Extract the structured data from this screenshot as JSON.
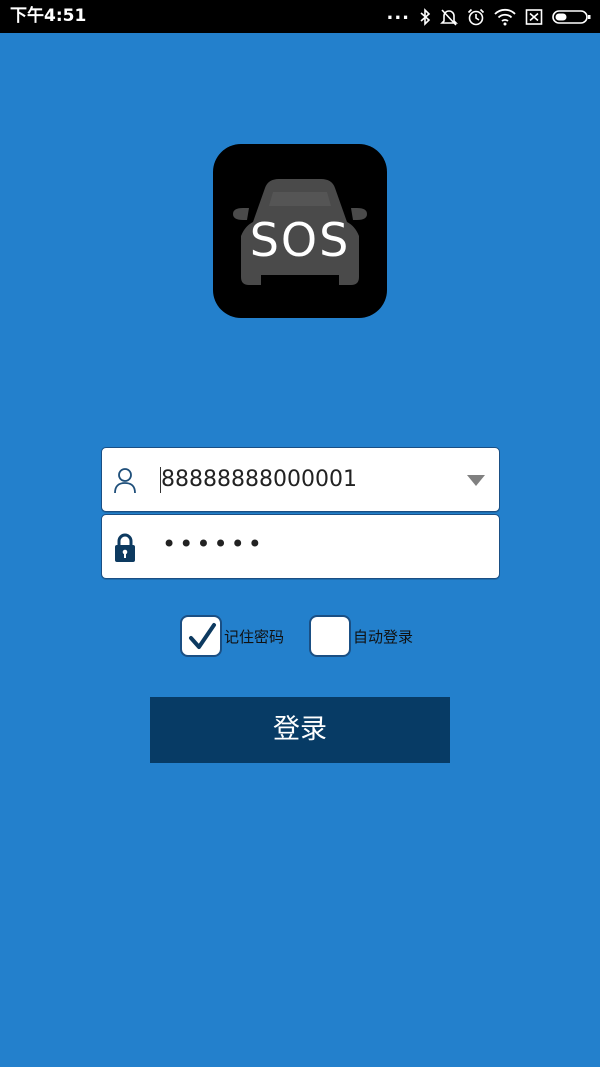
{
  "status_bar": {
    "time": "下午4:51",
    "dots": "...",
    "icons": [
      "bluetooth-icon",
      "mute-icon",
      "alarm-icon",
      "wifi-icon",
      "no-sim-icon",
      "battery-icon"
    ]
  },
  "logo": {
    "text": "SOS",
    "icon": "car-icon",
    "background_color": "#000000",
    "car_color": "#4a4a4a"
  },
  "login_form": {
    "username": {
      "value": "88888888000001",
      "icon": "user-icon",
      "dropdown_icon": "dropdown-arrow-icon"
    },
    "password": {
      "masked_value": "••••••",
      "icon": "lock-icon"
    },
    "remember_password": {
      "label": "记住密码",
      "checked": true
    },
    "auto_login": {
      "label": "自动登录",
      "checked": false
    },
    "submit_label": "登录"
  },
  "colors": {
    "background": "#2380cc",
    "button": "#073b65",
    "status_bar": "#000000"
  }
}
